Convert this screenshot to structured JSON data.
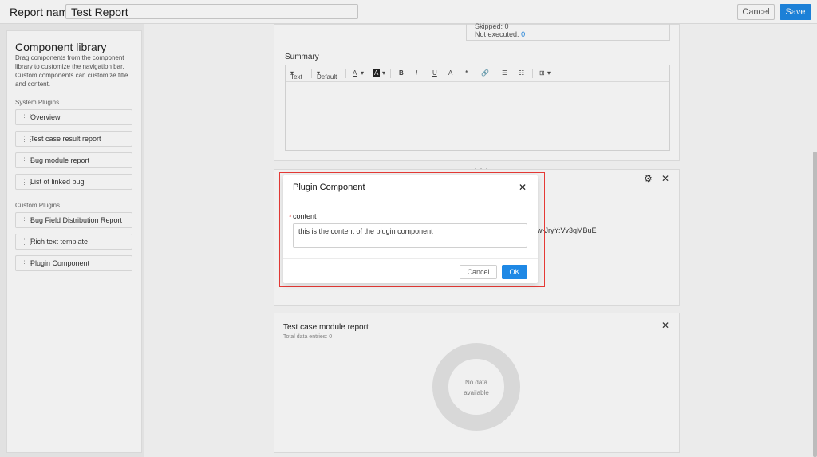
{
  "header": {
    "report_name_label": "Report name:",
    "report_name_value": "Test Report",
    "cancel_label": "Cancel",
    "save_label": "Save"
  },
  "sidebar": {
    "title": "Component library",
    "description": "Drag components from the component library to customize the navigation bar. Custom components can customize title and content.",
    "system_label": "System Plugins",
    "system_items": [
      "Overview",
      "Test case result report",
      "Bug module report",
      "List of linked bug"
    ],
    "custom_label": "Custom Plugins",
    "custom_items": [
      "Bug Field Distribution Report",
      "Rich text template",
      "Plugin Component"
    ]
  },
  "main": {
    "result": {
      "skipped_label": "Skipped:",
      "skipped_value": "0",
      "not_executed_label": "Not executed:",
      "not_executed_value": "0"
    },
    "summary_label": "Summary",
    "editor_toolbar": [
      "Text",
      "Default",
      "A",
      "A",
      "B",
      "I",
      "U",
      "A",
      "❝",
      "🔗",
      "☰",
      "☷",
      "⊞"
    ],
    "partial_text": "w-JryY:Vv3qMBuE",
    "test_case_module": {
      "title": "Test case module report",
      "subtitle": "Total data entries: 0",
      "empty_line1": "No data",
      "empty_line2": "available"
    }
  },
  "modal": {
    "title": "Plugin Component",
    "required_mark": "*",
    "field_label": "content",
    "field_value": "this is the content of the plugin component",
    "cancel_label": "Cancel",
    "ok_label": "OK"
  },
  "colors": {
    "primary": "#1e88e5",
    "highlight": "#e53935",
    "required": "#e53935"
  }
}
